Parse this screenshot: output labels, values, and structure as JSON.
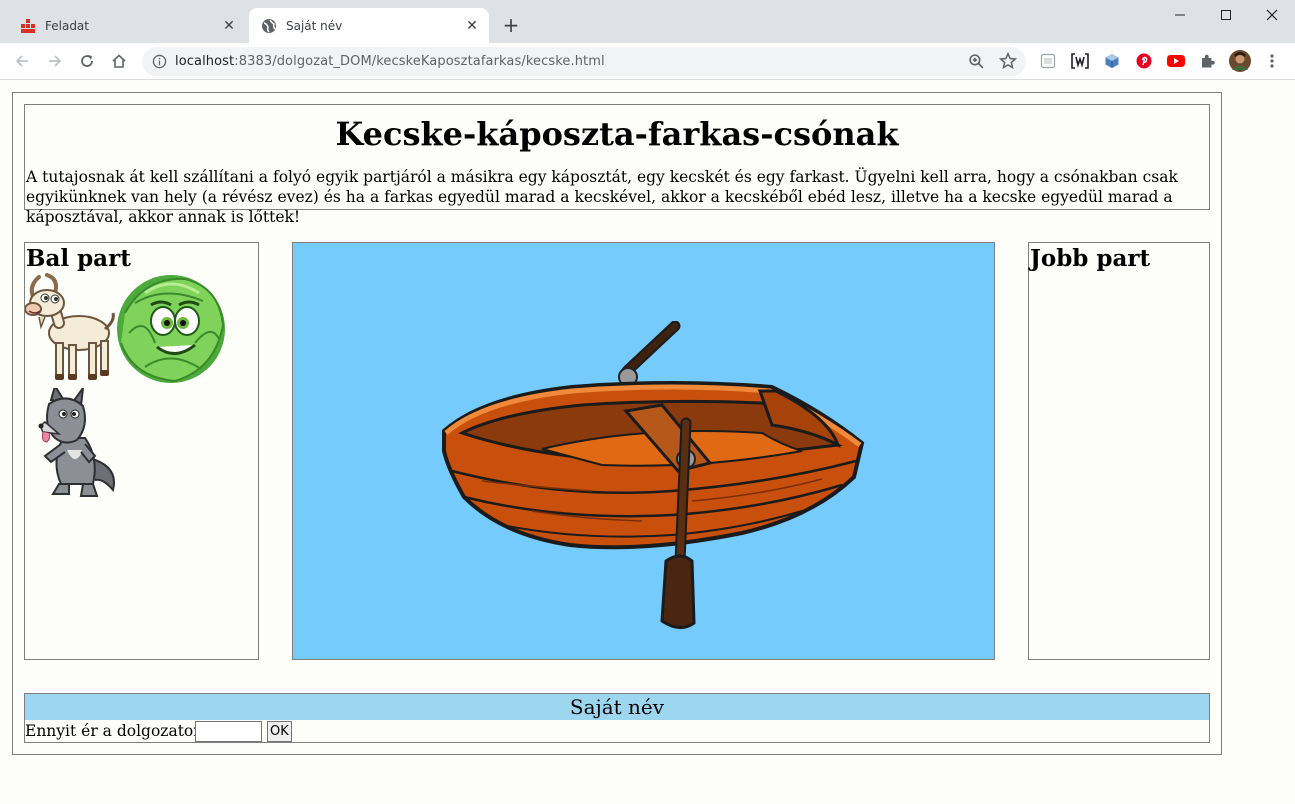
{
  "browser": {
    "tabs": [
      {
        "title": "Feladat",
        "active": false
      },
      {
        "title": "Saját név",
        "active": true
      }
    ],
    "url_host": "localhost",
    "url_rest": ":8383/dolgozat_DOM/kecskeKaposztafarkas/kecske.html"
  },
  "page": {
    "title": "Kecske-káposzta-farkas-csónak",
    "description": "A tutajosnak át kell szállítani a folyó egyik partjáról a másikra egy káposztát, egy kecskét és egy farkast. Ügyelni kell arra, hogy a csónakban csak egyikünknek van hely (a révész evez) és ha a farkas egyedül marad a kecskével, akkor a kecskéből ebéd lesz, illetve ha a kecske egyedül marad a káposztával, akkor annak is lőttek!",
    "left_bank": {
      "heading": "Bal part"
    },
    "right_bank": {
      "heading": "Jobb part"
    },
    "footer": {
      "name_label": "Saját név",
      "grade_label": "Ennyit ér a dolgozatom",
      "grade_value": "",
      "ok_label": "OK"
    }
  },
  "colors": {
    "river": "#74cbfc",
    "footer_bar": "#9dd7ef",
    "boat": "#c8500c"
  },
  "icons": [
    "goat-icon",
    "cabbage-icon",
    "wolf-icon",
    "boat-icon"
  ]
}
